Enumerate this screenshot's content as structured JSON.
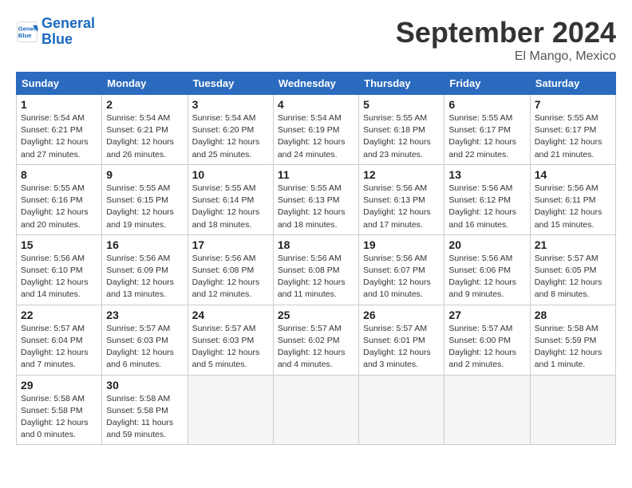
{
  "header": {
    "logo_line1": "General",
    "logo_line2": "Blue",
    "month": "September 2024",
    "location": "El Mango, Mexico"
  },
  "weekdays": [
    "Sunday",
    "Monday",
    "Tuesday",
    "Wednesday",
    "Thursday",
    "Friday",
    "Saturday"
  ],
  "weeks": [
    [
      {
        "day": "1",
        "info": "Sunrise: 5:54 AM\nSunset: 6:21 PM\nDaylight: 12 hours\nand 27 minutes."
      },
      {
        "day": "2",
        "info": "Sunrise: 5:54 AM\nSunset: 6:21 PM\nDaylight: 12 hours\nand 26 minutes."
      },
      {
        "day": "3",
        "info": "Sunrise: 5:54 AM\nSunset: 6:20 PM\nDaylight: 12 hours\nand 25 minutes."
      },
      {
        "day": "4",
        "info": "Sunrise: 5:54 AM\nSunset: 6:19 PM\nDaylight: 12 hours\nand 24 minutes."
      },
      {
        "day": "5",
        "info": "Sunrise: 5:55 AM\nSunset: 6:18 PM\nDaylight: 12 hours\nand 23 minutes."
      },
      {
        "day": "6",
        "info": "Sunrise: 5:55 AM\nSunset: 6:17 PM\nDaylight: 12 hours\nand 22 minutes."
      },
      {
        "day": "7",
        "info": "Sunrise: 5:55 AM\nSunset: 6:17 PM\nDaylight: 12 hours\nand 21 minutes."
      }
    ],
    [
      {
        "day": "8",
        "info": "Sunrise: 5:55 AM\nSunset: 6:16 PM\nDaylight: 12 hours\nand 20 minutes."
      },
      {
        "day": "9",
        "info": "Sunrise: 5:55 AM\nSunset: 6:15 PM\nDaylight: 12 hours\nand 19 minutes."
      },
      {
        "day": "10",
        "info": "Sunrise: 5:55 AM\nSunset: 6:14 PM\nDaylight: 12 hours\nand 18 minutes."
      },
      {
        "day": "11",
        "info": "Sunrise: 5:55 AM\nSunset: 6:13 PM\nDaylight: 12 hours\nand 18 minutes."
      },
      {
        "day": "12",
        "info": "Sunrise: 5:56 AM\nSunset: 6:13 PM\nDaylight: 12 hours\nand 17 minutes."
      },
      {
        "day": "13",
        "info": "Sunrise: 5:56 AM\nSunset: 6:12 PM\nDaylight: 12 hours\nand 16 minutes."
      },
      {
        "day": "14",
        "info": "Sunrise: 5:56 AM\nSunset: 6:11 PM\nDaylight: 12 hours\nand 15 minutes."
      }
    ],
    [
      {
        "day": "15",
        "info": "Sunrise: 5:56 AM\nSunset: 6:10 PM\nDaylight: 12 hours\nand 14 minutes."
      },
      {
        "day": "16",
        "info": "Sunrise: 5:56 AM\nSunset: 6:09 PM\nDaylight: 12 hours\nand 13 minutes."
      },
      {
        "day": "17",
        "info": "Sunrise: 5:56 AM\nSunset: 6:08 PM\nDaylight: 12 hours\nand 12 minutes."
      },
      {
        "day": "18",
        "info": "Sunrise: 5:56 AM\nSunset: 6:08 PM\nDaylight: 12 hours\nand 11 minutes."
      },
      {
        "day": "19",
        "info": "Sunrise: 5:56 AM\nSunset: 6:07 PM\nDaylight: 12 hours\nand 10 minutes."
      },
      {
        "day": "20",
        "info": "Sunrise: 5:56 AM\nSunset: 6:06 PM\nDaylight: 12 hours\nand 9 minutes."
      },
      {
        "day": "21",
        "info": "Sunrise: 5:57 AM\nSunset: 6:05 PM\nDaylight: 12 hours\nand 8 minutes."
      }
    ],
    [
      {
        "day": "22",
        "info": "Sunrise: 5:57 AM\nSunset: 6:04 PM\nDaylight: 12 hours\nand 7 minutes."
      },
      {
        "day": "23",
        "info": "Sunrise: 5:57 AM\nSunset: 6:03 PM\nDaylight: 12 hours\nand 6 minutes."
      },
      {
        "day": "24",
        "info": "Sunrise: 5:57 AM\nSunset: 6:03 PM\nDaylight: 12 hours\nand 5 minutes."
      },
      {
        "day": "25",
        "info": "Sunrise: 5:57 AM\nSunset: 6:02 PM\nDaylight: 12 hours\nand 4 minutes."
      },
      {
        "day": "26",
        "info": "Sunrise: 5:57 AM\nSunset: 6:01 PM\nDaylight: 12 hours\nand 3 minutes."
      },
      {
        "day": "27",
        "info": "Sunrise: 5:57 AM\nSunset: 6:00 PM\nDaylight: 12 hours\nand 2 minutes."
      },
      {
        "day": "28",
        "info": "Sunrise: 5:58 AM\nSunset: 5:59 PM\nDaylight: 12 hours\nand 1 minute."
      }
    ],
    [
      {
        "day": "29",
        "info": "Sunrise: 5:58 AM\nSunset: 5:58 PM\nDaylight: 12 hours\nand 0 minutes."
      },
      {
        "day": "30",
        "info": "Sunrise: 5:58 AM\nSunset: 5:58 PM\nDaylight: 11 hours\nand 59 minutes."
      },
      {
        "day": "",
        "info": ""
      },
      {
        "day": "",
        "info": ""
      },
      {
        "day": "",
        "info": ""
      },
      {
        "day": "",
        "info": ""
      },
      {
        "day": "",
        "info": ""
      }
    ]
  ]
}
